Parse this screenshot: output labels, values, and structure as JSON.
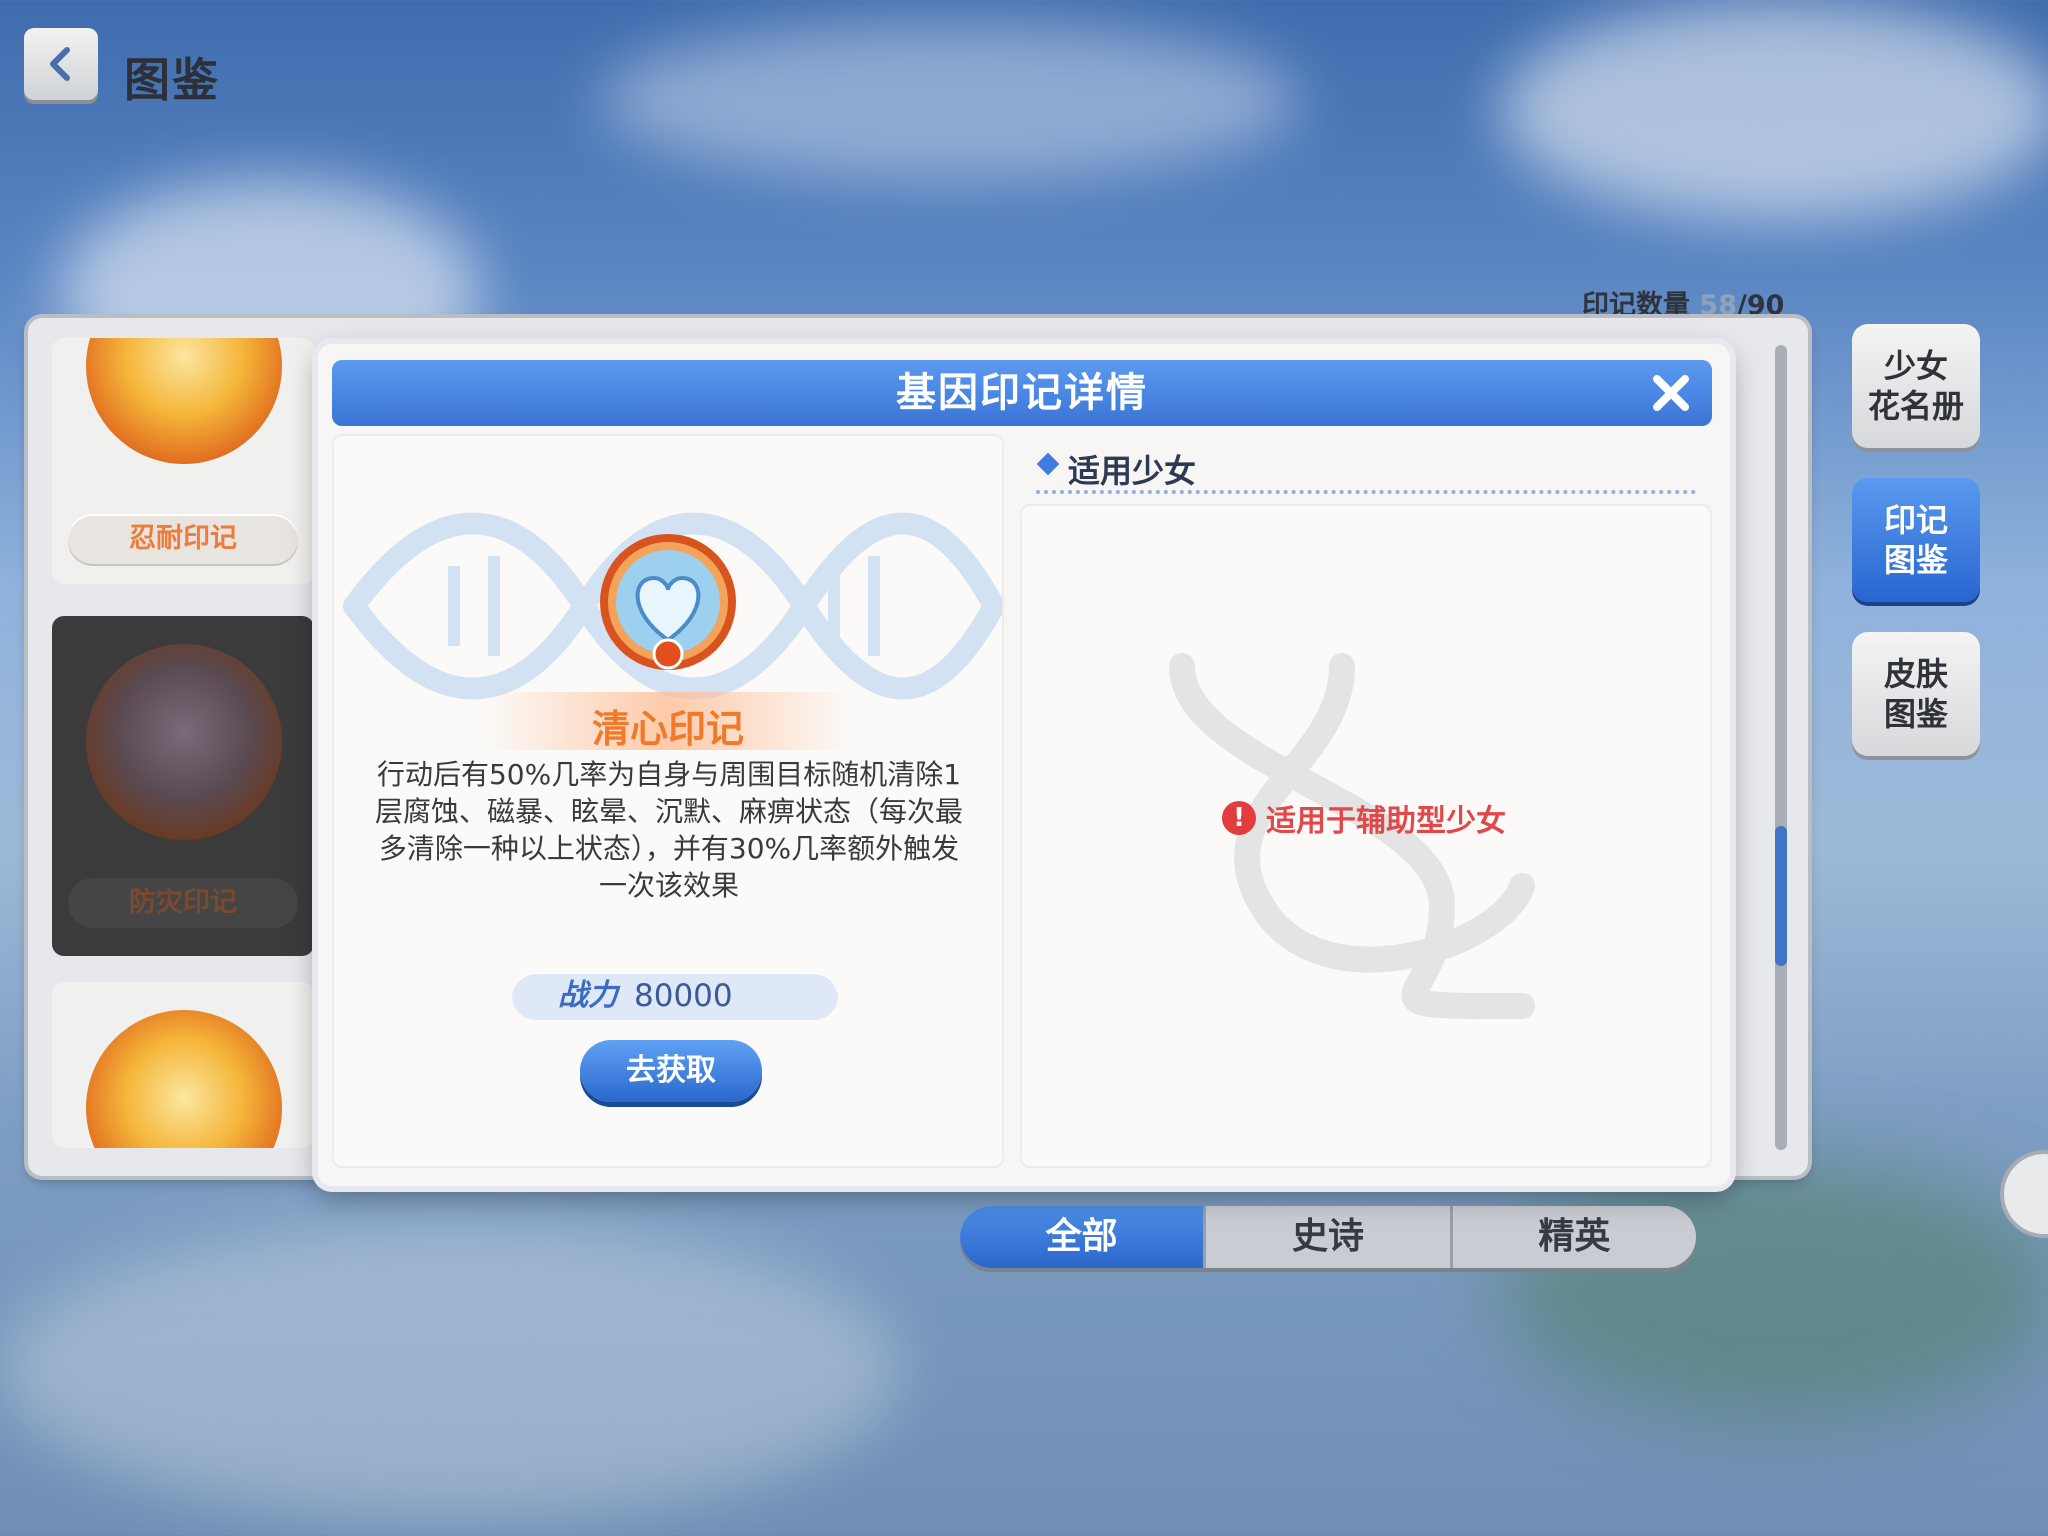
{
  "header": {
    "title": "图鉴"
  },
  "collection": {
    "label": "印记数量 ",
    "current": "58",
    "total": "/90"
  },
  "cards": [
    {
      "name": "忍耐印记",
      "state": "normal"
    },
    {
      "name": "防灾印记",
      "state": "selected"
    },
    {
      "name": "",
      "state": "normal"
    }
  ],
  "side_tabs": [
    {
      "label": "少女\n花名册",
      "active": false
    },
    {
      "label": "印记\n图鉴",
      "active": true
    },
    {
      "label": "皮肤\n图鉴",
      "active": false
    }
  ],
  "filters": [
    {
      "label": "全部",
      "active": true
    },
    {
      "label": "史诗",
      "active": false
    },
    {
      "label": "精英",
      "active": false
    }
  ],
  "modal": {
    "title": "基因印记详情",
    "mark_name": "清心印记",
    "description": "行动后有50%几率为自身与周围目标随机清除1层腐蚀、磁暴、眩晕、沉默、麻痹状态（每次最多清除一种以上状态），并有30%几率额外触发一次该效果",
    "power_label": "战力",
    "power_value": "80000",
    "acquire_label": "去获取",
    "section_title": "适用少女",
    "applicable_hint": "适用于辅助型少女"
  },
  "colors": {
    "accent": "#3a74d6",
    "mark_orange": "#ef7a2a",
    "warning_red": "#e24848"
  }
}
